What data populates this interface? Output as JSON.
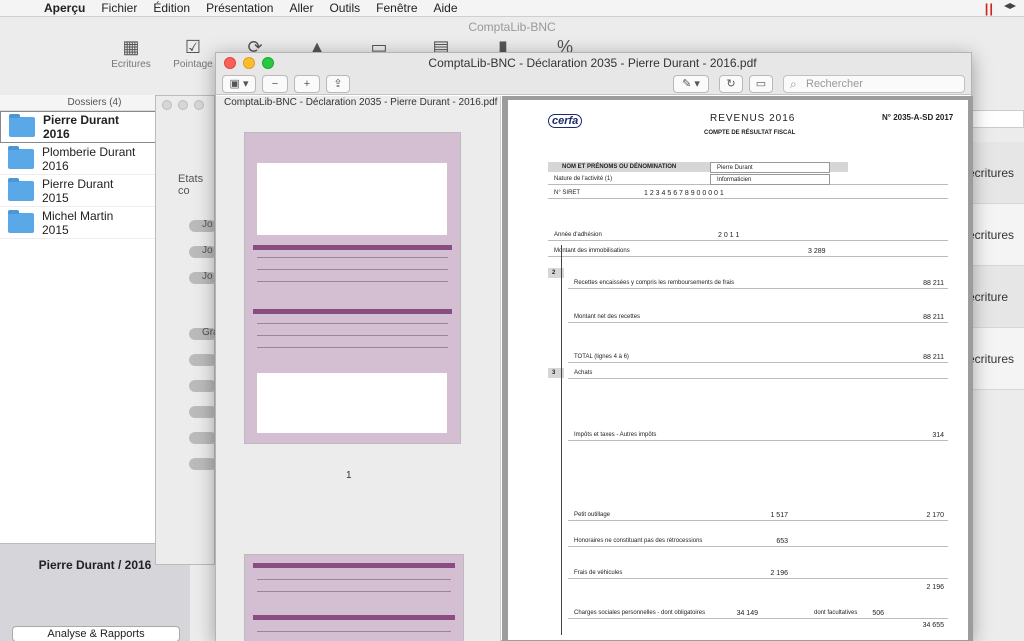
{
  "menubar": {
    "apple_icon": "apple-icon",
    "app_name": "Aperçu",
    "items": [
      "Fichier",
      "Édition",
      "Présentation",
      "Aller",
      "Outils",
      "Fenêtre",
      "Aide"
    ]
  },
  "bgapp": {
    "title": "ComptaLib-BNC",
    "toolbar": [
      {
        "label": "Ecritures",
        "icon": "calendar-icon"
      },
      {
        "label": "Pointage",
        "icon": "check-icon"
      },
      {
        "label": "",
        "icon": "sync-icon"
      },
      {
        "label": "",
        "icon": "road-icon"
      },
      {
        "label": "",
        "icon": "car-icon"
      },
      {
        "label": "",
        "icon": "printer-icon"
      },
      {
        "label": "",
        "icon": "book-icon"
      },
      {
        "label": "",
        "icon": "percent-icon"
      }
    ],
    "sidebar": {
      "header": "Dossiers (4)",
      "folders": [
        {
          "name": "Pierre Durant",
          "year": "2016",
          "selected": true
        },
        {
          "name": "Plomberie Durant",
          "year": "2016",
          "selected": false
        },
        {
          "name": "Pierre Durant",
          "year": "2015",
          "selected": false
        },
        {
          "name": "Michel Martin",
          "year": "2015",
          "selected": false
        }
      ],
      "current": "Pierre Durant / 2016",
      "report_button": "Analyse & Rapports"
    },
    "right_list": [
      "écritures",
      "écritures",
      "écriture",
      "écritures"
    ]
  },
  "etats": {
    "label": "Etats co",
    "pills": [
      "Jo",
      "Jo",
      "Jo",
      "Gra"
    ]
  },
  "preview": {
    "window_title": "ComptaLib-BNC - Déclaration 2035 - Pierre Durant - 2016.pdf",
    "sidebar_title": "ComptaLib-BNC - Déclaration 2035 - Pierre Durant - 2016.pdf",
    "search_placeholder": "Rechercher",
    "page_number": "1"
  },
  "document": {
    "cerfa": "cerfa",
    "revenus": "REVENUS 2016",
    "form_number": "N° 2035-A-SD 2017",
    "subtitle": "COMPTE DE RÉSULTAT FISCAL",
    "section1": "NOM ET PRÉNOMS OU DÉNOMINATION",
    "name_value": "Pierre Durant",
    "activity_label": "Nature de l'activité (1)",
    "activity_value": "Informaticien",
    "siret_label": "N° SIRET",
    "siret_value": "1 2 3 4 5 6 7 8 9 0 0 0 0 1",
    "aa_label": "Année d'adhésion",
    "aa_value": "2 0 1 1",
    "immo_label": "Montant des immobilisations",
    "immo_value": "3 289",
    "rows": [
      {
        "label": "Recettes encaissées y compris les remboursements de frais",
        "value": "88 211"
      },
      {
        "label": "Montant net des recettes",
        "value": "88 211"
      },
      {
        "label": "TOTAL (lignes 4 à 6)",
        "value": "88 211"
      },
      {
        "label": "Achats",
        "value": ""
      },
      {
        "label": "Impôts et taxes - Autres impôts",
        "value": "314"
      },
      {
        "label": "Petit outillage",
        "value": "1 517"
      },
      {
        "label": "Honoraires ne constituant pas des rétrocessions",
        "value": "653"
      },
      {
        "label": "Total travaux, fournitures et services extérieurs",
        "value": "2 170"
      },
      {
        "label": "Frais de véhicules",
        "value": "2 196"
      },
      {
        "label": "Total transport et déplacements",
        "value": "2 196"
      },
      {
        "label": "Charges sociales personnelles - dont obligatoires",
        "value": "34 149"
      },
      {
        "label": "dont facultatives",
        "value": "506"
      },
      {
        "label": "Total charges sociales",
        "value": "34 655"
      }
    ]
  }
}
